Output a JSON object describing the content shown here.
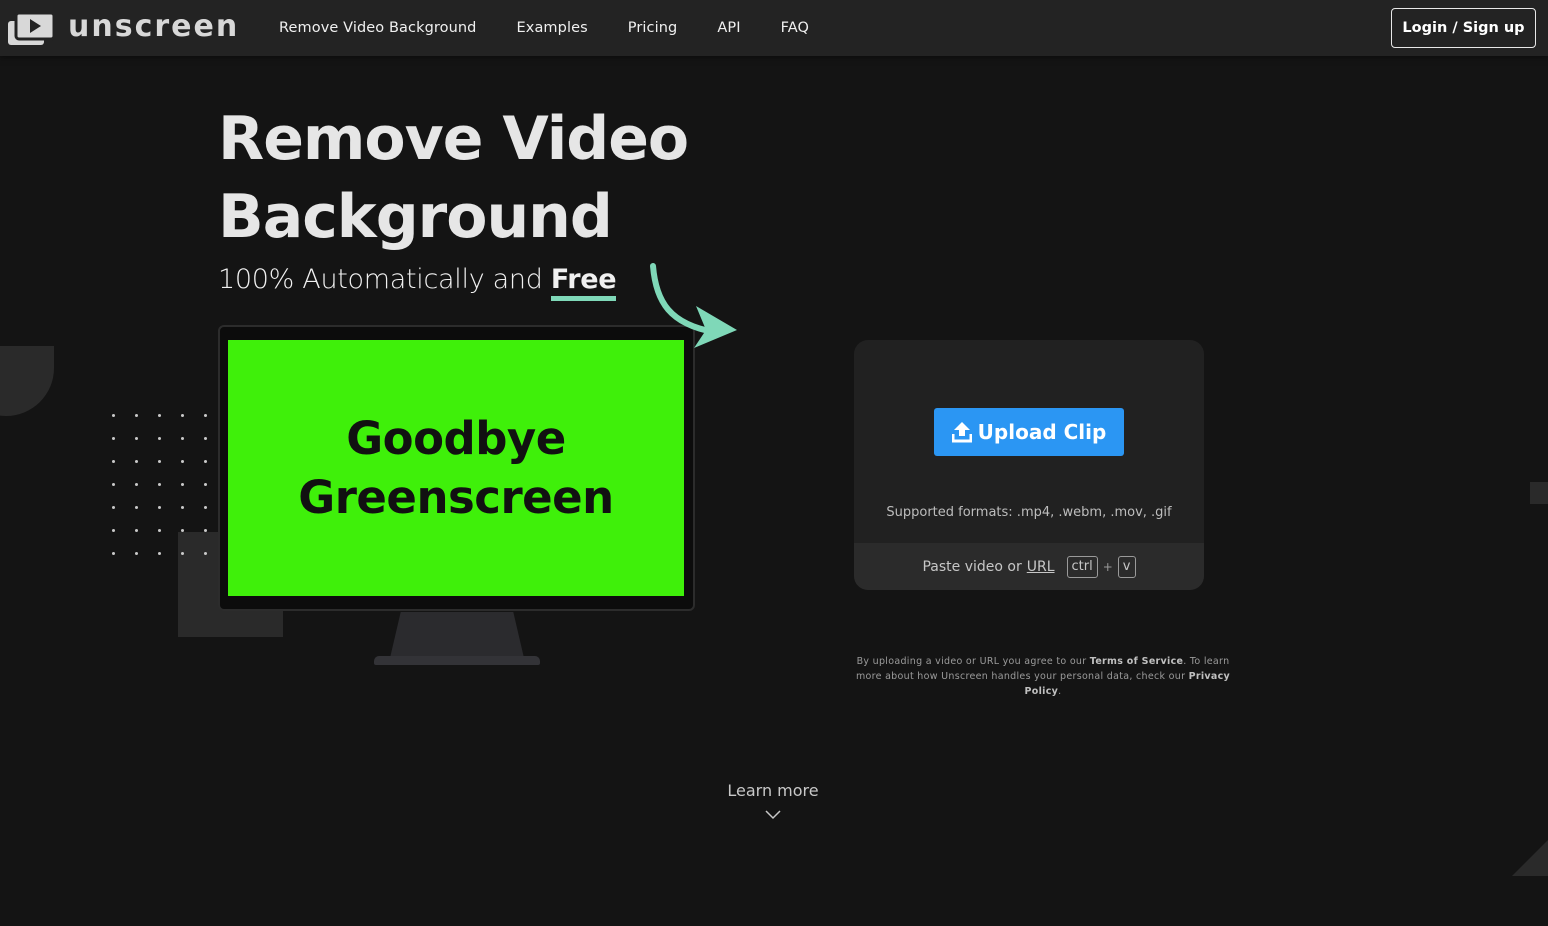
{
  "brand": {
    "name": "unscreen"
  },
  "nav": {
    "links": [
      "Remove Video Background",
      "Examples",
      "Pricing",
      "API",
      "FAQ"
    ],
    "login_label": "Login / Sign up"
  },
  "hero": {
    "title_line1": "Remove Video",
    "title_line2": "Background",
    "subtitle_prefix": "100% Automatically and",
    "subtitle_emphasis": "Free",
    "screen_line1": "Goodbye",
    "screen_line2": "Greenscreen"
  },
  "upload": {
    "button_label": "Upload Clip",
    "formats": "Supported formats: .mp4, .webm, .mov, .gif",
    "paste_prefix": "Paste video or",
    "paste_url": "URL",
    "key1": "ctrl",
    "key_plus": "+",
    "key2": "v"
  },
  "terms": {
    "part1": "By uploading a video or URL you agree to our",
    "tos_link": "Terms of Service",
    "part2": ". To learn more about how Unscreen handles your personal data, check our",
    "privacy_link": "Privacy Policy",
    "part3": "."
  },
  "learn_more": "Learn more",
  "colors": {
    "background": "#141414",
    "navbar": "#232323",
    "accent_blue": "#2b96f3",
    "accent_mint": "#7fd8b8",
    "greenscreen": "#3ff00a"
  },
  "icons": [
    "logo-play-icon",
    "upload-icon",
    "curved-arrow-icon",
    "chevron-down-icon"
  ]
}
